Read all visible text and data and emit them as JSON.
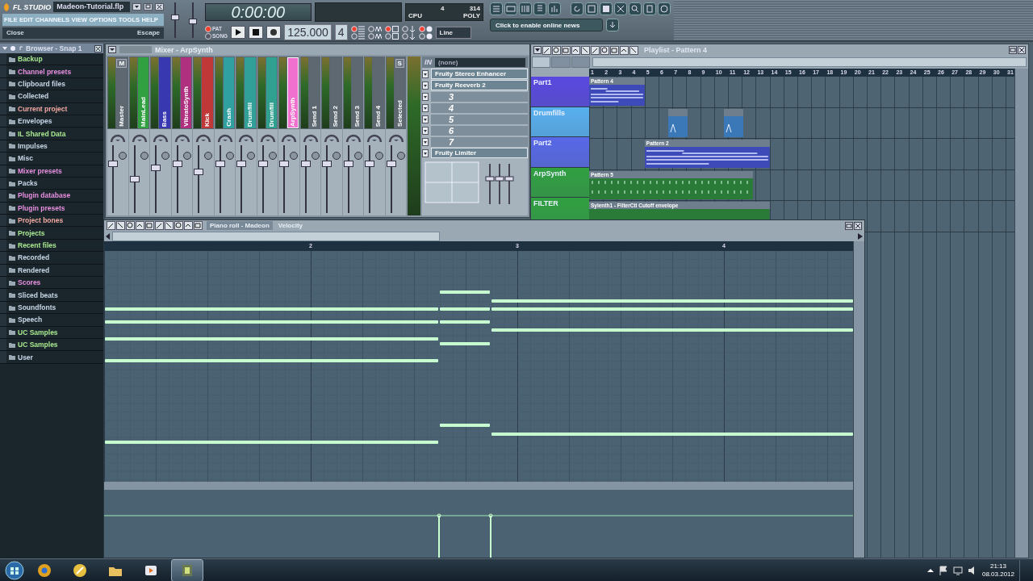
{
  "title_bar": {
    "logo": "FL STUDIO",
    "project": "Madeon-Tutorial.flp"
  },
  "menu": [
    "FILE",
    "EDIT",
    "CHANNELS",
    "VIEW",
    "OPTIONS",
    "TOOLS",
    "HELP"
  ],
  "hint_bar": {
    "text": "Close",
    "shortcut": "Escape"
  },
  "master_volume": {
    "level": 0.6
  },
  "master_pitch": {
    "level": 0.45
  },
  "transport": {
    "time": "0:00:00",
    "tempo": "125.000",
    "pattern": "4",
    "snap": "Line",
    "modes": [
      {
        "label": "PAT",
        "selected": true
      },
      {
        "label": "SONG",
        "selected": false
      }
    ]
  },
  "toggles": [
    {
      "on": true
    },
    {
      "on": false
    },
    {
      "on": true
    },
    {
      "on": false
    },
    {
      "on": true
    },
    {
      "on": false
    },
    {
      "on": false
    },
    {
      "on": false
    },
    {
      "on": false
    },
    {
      "on": false
    }
  ],
  "cpu_panel": {
    "cpu": "4",
    "poly": "314",
    "cpu_label": "CPU",
    "poly_label": "POLY"
  },
  "news": {
    "placeholder": "Click to enable online news"
  },
  "browser": {
    "title": "Browser - Snap 1",
    "items": [
      {
        "label": "Backup",
        "color": "#a8e890"
      },
      {
        "label": "Channel presets",
        "color": "#e890e0"
      },
      {
        "label": "Clipboard files",
        "color": "#c8d8e8"
      },
      {
        "label": "Collected",
        "color": "#c8d8e8"
      },
      {
        "label": "Current project",
        "color": "#f0a8a0"
      },
      {
        "label": "Envelopes",
        "color": "#c8d8e8"
      },
      {
        "label": "IL Shared Data",
        "color": "#a8e890"
      },
      {
        "label": "Impulses",
        "color": "#c8d8e8"
      },
      {
        "label": "Misc",
        "color": "#c8d8e8"
      },
      {
        "label": "Mixer presets",
        "color": "#e890e0"
      },
      {
        "label": "Packs",
        "color": "#c8d8e8"
      },
      {
        "label": "Plugin database",
        "color": "#e890e0"
      },
      {
        "label": "Plugin presets",
        "color": "#e890e0"
      },
      {
        "label": "Project bones",
        "color": "#f0a8a0"
      },
      {
        "label": "Projects",
        "color": "#a8e890"
      },
      {
        "label": "Recent files",
        "color": "#a8e890"
      },
      {
        "label": "Recorded",
        "color": "#c8d8e8"
      },
      {
        "label": "Rendered",
        "color": "#c8d8e8"
      },
      {
        "label": "Scores",
        "color": "#e890e0"
      },
      {
        "label": "Sliced beats",
        "color": "#c8d8e8"
      },
      {
        "label": "Soundfonts",
        "color": "#c8d8e8"
      },
      {
        "label": "Speech",
        "color": "#c8d8e8"
      },
      {
        "label": "UC Samples",
        "color": "#a8e890"
      },
      {
        "label": "UC Samples",
        "color": "#a8e890"
      },
      {
        "label": "User",
        "color": "#c8d8e8"
      }
    ]
  },
  "mixer": {
    "title": "Mixer - ArpSynth",
    "tracks": [
      {
        "name": "Master",
        "color": "#5d6870",
        "tag": "M",
        "selected": false,
        "level": 0.75
      },
      {
        "name": "MainLead",
        "color": "#30a040",
        "selected": false,
        "level": 0.5
      },
      {
        "name": "Bass",
        "color": "#3838b0",
        "selected": false,
        "level": 0.68
      },
      {
        "name": "VibratoSynth",
        "color": "#b03080",
        "selected": false,
        "level": 0.75
      },
      {
        "name": "Kick",
        "color": "#c03838",
        "selected": false,
        "level": 0.62
      },
      {
        "name": "Crash",
        "color": "#30a0a0",
        "selected": false,
        "level": 0.75
      },
      {
        "name": "Drumfill",
        "color": "#30a098",
        "selected": false,
        "level": 0.75
      },
      {
        "name": "Drumfill",
        "color": "#30a090",
        "selected": false,
        "level": 0.75
      },
      {
        "name": "ArpSynth",
        "color": "#f070d0",
        "selected": true,
        "level": 0.75
      },
      {
        "name": "Send 1",
        "color": "#5d6870",
        "selected": false,
        "level": 0.75
      },
      {
        "name": "Send 2",
        "color": "#5d6870",
        "selected": false,
        "level": 0.75
      },
      {
        "name": "Send 3",
        "color": "#5d6870",
        "selected": false,
        "level": 0.75
      },
      {
        "name": "Send 4",
        "color": "#5d6870",
        "selected": false,
        "level": 0.75
      },
      {
        "name": "Selected",
        "color": "#5d6870",
        "tag": "S",
        "selected": false,
        "level": 0.75
      }
    ],
    "input": {
      "label": "IN",
      "value": "(none)"
    },
    "slots": [
      {
        "kind": "plugin",
        "label": "Fruity Stereo Enhancer"
      },
      {
        "kind": "plugin",
        "label": "Fruity Reeverb 2"
      },
      {
        "kind": "empty",
        "label": "3"
      },
      {
        "kind": "empty",
        "label": "4"
      },
      {
        "kind": "empty",
        "label": "5"
      },
      {
        "kind": "empty",
        "label": "6"
      },
      {
        "kind": "empty",
        "label": "7"
      },
      {
        "kind": "plugin",
        "label": "Fruity Limiter"
      }
    ]
  },
  "playlist": {
    "title": "Playlist - Pattern 4",
    "view_tabs": [
      {
        "selected": true
      },
      {
        "selected": false
      },
      {
        "selected": false
      }
    ],
    "ruler": [
      "1",
      "2",
      "3",
      "4",
      "5",
      "6",
      "7",
      "8",
      "9",
      "10",
      "11",
      "12",
      "13",
      "14",
      "15",
      "16",
      "17",
      "18",
      "19",
      "20",
      "21",
      "22",
      "23",
      "24",
      "25",
      "26",
      "27",
      "28",
      "29",
      "30",
      "31"
    ],
    "tracks": [
      {
        "name": "Part1",
        "color": "#5a48e0",
        "clips": [
          {
            "kind": "pattern",
            "label": "Pattern 4"
          }
        ]
      },
      {
        "name": "Drumfills",
        "color": "#58b0f0",
        "clips": [
          {
            "kind": "drum"
          },
          {
            "kind": "drum"
          }
        ]
      },
      {
        "name": "Part2",
        "color": "#5868e8",
        "clips": [
          {
            "kind": "pattern",
            "label": "Pattern 2"
          }
        ]
      },
      {
        "name": "ArpSynth",
        "color": "#30a040",
        "clips": [
          {
            "kind": "arp",
            "label": "Pattern 5"
          }
        ]
      },
      {
        "name": "FILTER",
        "color": "#30a040",
        "clips": [
          {
            "kind": "automation",
            "label": "Sylenth1 - FilterCtl Cutoff envelope"
          }
        ]
      }
    ]
  },
  "piano_roll": {
    "title": "Piano roll - Madeon",
    "target": "Velocity",
    "ruler": [
      "2",
      "3",
      "4"
    ]
  },
  "taskbar": {
    "apps": [
      {
        "active": false
      },
      {
        "active": false
      },
      {
        "active": false
      },
      {
        "active": false
      },
      {
        "active": true
      }
    ],
    "time": "21:13",
    "date": "08.03.2012"
  }
}
